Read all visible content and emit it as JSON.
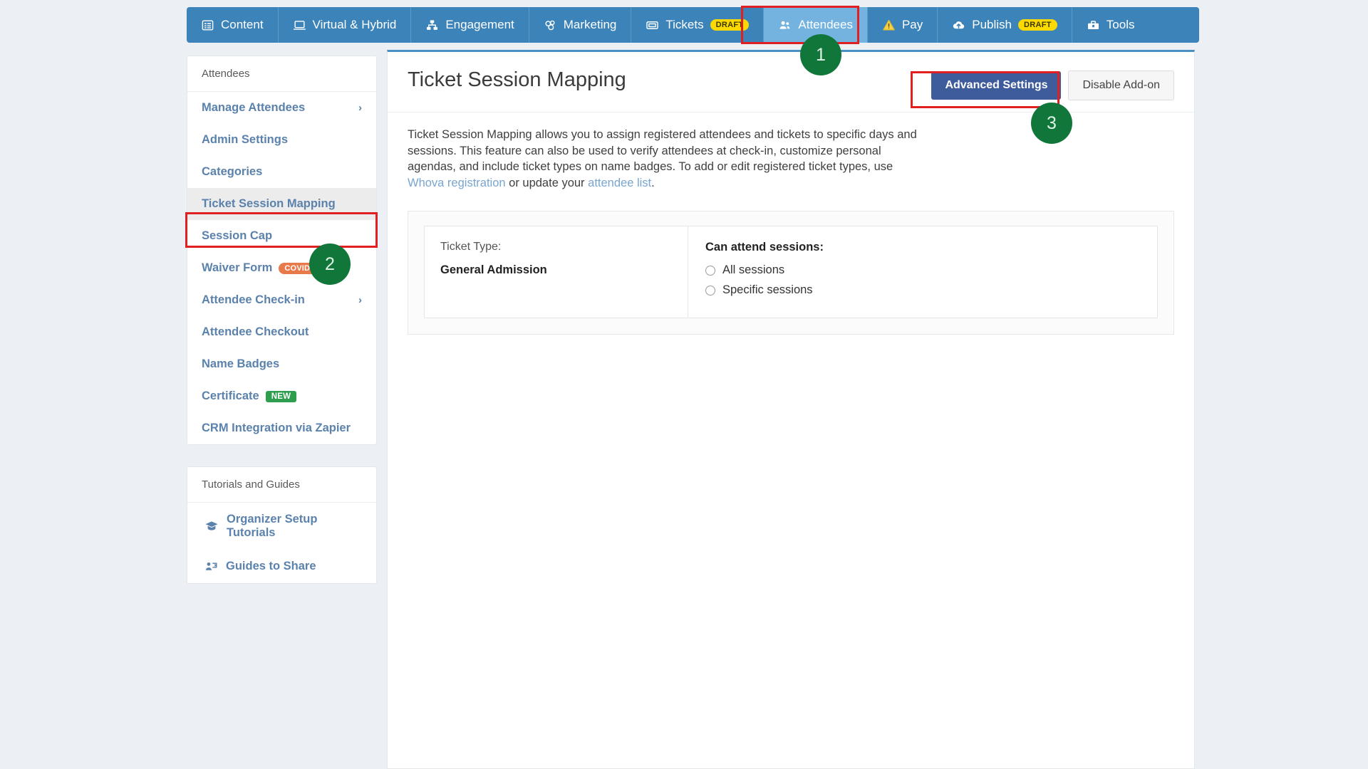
{
  "colors": {
    "nav_bg": "#3b83b8",
    "nav_active": "#74b3e0",
    "page_bg": "#eceff3",
    "link": "#7aa5cf",
    "sidebar_link": "#5b82ac",
    "primary_button": "#3e5b9b",
    "highlight": "#e02020",
    "step_badge": "#11763a",
    "draft_pill": "#fcd900",
    "covid_badge": "#e8794a",
    "new_badge": "#2e9e4e"
  },
  "topnav": {
    "items": [
      {
        "label": "Content",
        "icon": "list-content-icon",
        "badge": null,
        "active": false
      },
      {
        "label": "Virtual & Hybrid",
        "icon": "laptop-icon",
        "badge": null,
        "active": false
      },
      {
        "label": "Engagement",
        "icon": "network-icon",
        "badge": null,
        "active": false
      },
      {
        "label": "Marketing",
        "icon": "megaphone-icon",
        "badge": null,
        "active": false
      },
      {
        "label": "Tickets",
        "icon": "ticket-icon",
        "badge": "DRAFT",
        "active": false
      },
      {
        "label": "Attendees",
        "icon": "people-icon",
        "badge": null,
        "active": true
      },
      {
        "label": "Pay",
        "icon": "warning-triangle-icon",
        "badge": null,
        "active": false
      },
      {
        "label": "Publish",
        "icon": "cloud-upload-icon",
        "badge": "DRAFT",
        "active": false
      },
      {
        "label": "Tools",
        "icon": "toolbox-icon",
        "badge": null,
        "active": false
      }
    ]
  },
  "sidebar": {
    "header": "Attendees",
    "items": [
      {
        "label": "Manage Attendees",
        "chevron": true,
        "badge": null,
        "selected": false
      },
      {
        "label": "Admin Settings",
        "chevron": false,
        "badge": null,
        "selected": false
      },
      {
        "label": "Categories",
        "chevron": false,
        "badge": null,
        "selected": false
      },
      {
        "label": "Ticket Session Mapping",
        "chevron": false,
        "badge": null,
        "selected": true
      },
      {
        "label": "Session Cap",
        "chevron": false,
        "badge": null,
        "selected": false
      },
      {
        "label": "Waiver Form",
        "chevron": false,
        "badge": "COVID-19",
        "badge_kind": "covid",
        "selected": false
      },
      {
        "label": "Attendee Check-in",
        "chevron": true,
        "badge": null,
        "selected": false
      },
      {
        "label": "Attendee Checkout",
        "chevron": false,
        "badge": null,
        "selected": false
      },
      {
        "label": "Name Badges",
        "chevron": false,
        "badge": null,
        "selected": false
      },
      {
        "label": "Certificate",
        "chevron": false,
        "badge": "NEW",
        "badge_kind": "new",
        "selected": false
      },
      {
        "label": "CRM Integration via Zapier",
        "chevron": false,
        "badge": null,
        "selected": false
      }
    ],
    "tutorials": {
      "header": "Tutorials and Guides",
      "items": [
        {
          "label": "Organizer Setup Tutorials",
          "icon": "graduation-cap-icon"
        },
        {
          "label": "Guides to Share",
          "icon": "share-person-icon"
        }
      ]
    }
  },
  "main": {
    "title": "Ticket Session Mapping",
    "advanced_settings_label": "Advanced Settings",
    "disable_addon_label": "Disable Add-on",
    "description": {
      "part1": "Ticket Session Mapping allows you to assign registered attendees and tickets to specific days and sessions. This feature can also be used to verify attendees at check-in, customize personal agendas, and include ticket types on name badges. To add or edit registered ticket types, use ",
      "link1": "Whova registration",
      "part2": " or update your ",
      "link2": "attendee list",
      "part3": "."
    },
    "ticket_card": {
      "ticket_type_label": "Ticket Type:",
      "ticket_type_value": "General Admission",
      "sessions_label": "Can attend sessions:",
      "options": [
        {
          "label": "All sessions",
          "selected": false
        },
        {
          "label": "Specific sessions",
          "selected": false
        }
      ]
    }
  },
  "annotations": {
    "steps": [
      {
        "number": "1",
        "target": "attendees-nav-tab"
      },
      {
        "number": "2",
        "target": "sidebar-item-ticket-session-mapping"
      },
      {
        "number": "3",
        "target": "advanced-settings-button"
      }
    ]
  }
}
